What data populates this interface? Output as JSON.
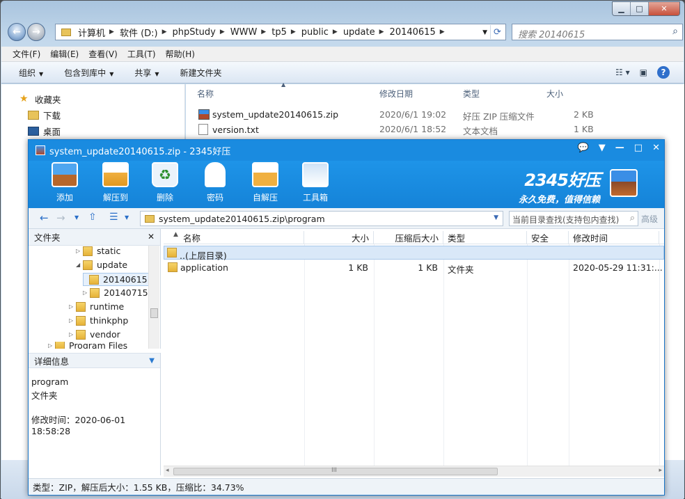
{
  "explorer": {
    "window_buttons": {
      "minimize": "▁",
      "maximize": "□",
      "close": "✕"
    },
    "breadcrumbs": [
      "计算机",
      "软件 (D:)",
      "phpStudy",
      "WWW",
      "tp5",
      "public",
      "update",
      "20140615"
    ],
    "search_placeholder": "搜索 20140615",
    "menu": [
      "文件(F)",
      "编辑(E)",
      "查看(V)",
      "工具(T)",
      "帮助(H)"
    ],
    "toolbar": {
      "organize": "组织",
      "include_library": "包含到库中",
      "share": "共享",
      "new_folder": "新建文件夹"
    },
    "nav": {
      "favorites": "收藏夹",
      "downloads": "下载",
      "desktop": "桌面"
    },
    "columns": {
      "name": "名称",
      "modified": "修改日期",
      "type": "类型",
      "size": "大小"
    },
    "files": [
      {
        "name": "system_update20140615.zip",
        "modified": "2020/6/1 19:02",
        "type": "好压 ZIP 压缩文件",
        "size": "2 KB"
      },
      {
        "name": "version.txt",
        "modified": "2020/6/1 18:52",
        "type": "文本文档",
        "size": "1 KB"
      }
    ]
  },
  "zip": {
    "title": "system_update20140615.zip - 2345好压",
    "ribbon": {
      "add": "添加",
      "extract_to": "解压到",
      "delete": "删除",
      "password": "密码",
      "self_extract": "自解压",
      "toolbox": "工具箱"
    },
    "brand_logo": "2345好压",
    "brand_slogan": "永久免费，值得信赖",
    "path": "system_update20140615.zip\\program",
    "search_placeholder": "当前目录查找(支持包内查找)",
    "advanced": "高级",
    "tree_title": "文件夹",
    "tree": [
      "static",
      "update",
      "20140615",
      "20140715",
      "runtime",
      "thinkphp",
      "vendor",
      "Program Files"
    ],
    "detail_title": "详细信息",
    "detail": {
      "name": "program",
      "type": "文件夹",
      "modified": "修改时间：2020-06-01 18:58:28"
    },
    "columns": {
      "name": "名称",
      "size": "大小",
      "packed": "压缩后大小",
      "type": "类型",
      "security": "安全",
      "modified": "修改时间"
    },
    "rows": [
      {
        "name": "..(上层目录)",
        "size": "",
        "packed": "",
        "type": "",
        "modified": ""
      },
      {
        "name": "application",
        "size": "1 KB",
        "packed": "1 KB",
        "type": "文件夹",
        "modified": "2020-05-29 11:31:..."
      }
    ],
    "hscroll_grip": "III",
    "status": "类型：ZIP，解压后大小：1.55 KB，压缩比：34.73%"
  },
  "colors": {
    "accent": "#1a8be0",
    "folder": "#e8c35a"
  }
}
